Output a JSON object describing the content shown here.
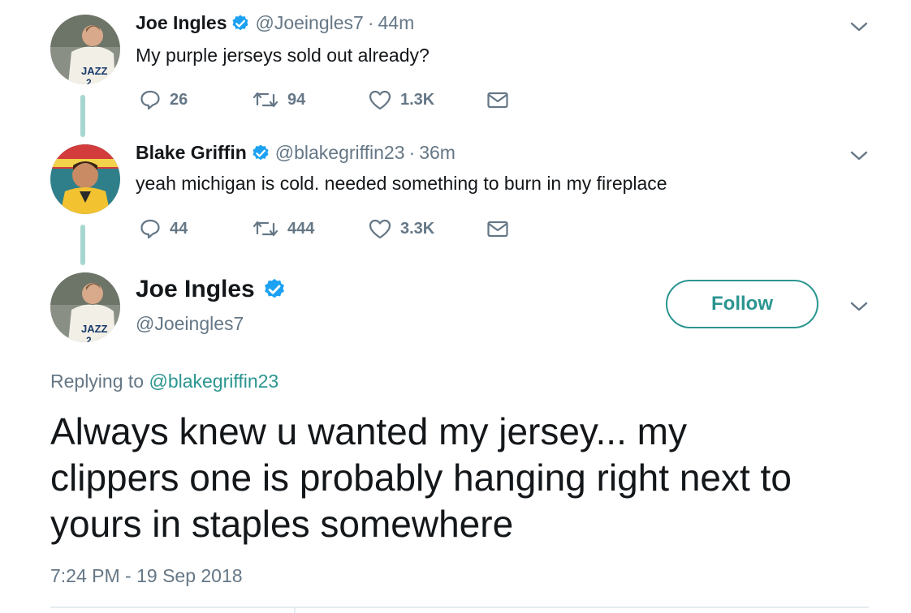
{
  "tweets": [
    {
      "name": "Joe Ingles",
      "handle": "@Joeingles7",
      "time": "44m",
      "text": "My purple jerseys sold out already?",
      "replies": "26",
      "retweets": "94",
      "likes": "1.3K"
    },
    {
      "name": "Blake Griffin",
      "handle": "@blakegriffin23",
      "time": "36m",
      "text": "yeah michigan is cold. needed something to burn in my fireplace",
      "replies": "44",
      "retweets": "444",
      "likes": "3.3K"
    }
  ],
  "main": {
    "name": "Joe Ingles",
    "handle": "@Joeingles7",
    "follow_label": "Follow",
    "replying_prefix": "Replying to",
    "replying_to": "@blakegriffin23",
    "text_lines": [
      "Always knew u wanted my jersey... my",
      "clippers one is probably hanging right next to",
      "yours in staples somewhere"
    ],
    "timestamp": "7:24 PM - 19 Sep 2018"
  },
  "icons": {
    "reply": "reply-icon",
    "retweet": "retweet-icon",
    "like": "heart-icon",
    "dm": "envelope-icon",
    "verified": "verified-badge-icon",
    "chevron": "chevron-down-icon"
  },
  "colors": {
    "accent": "#2b9590",
    "verified": "#1da1f2",
    "muted": "#657786",
    "thread_line": "#a7d6cf"
  }
}
